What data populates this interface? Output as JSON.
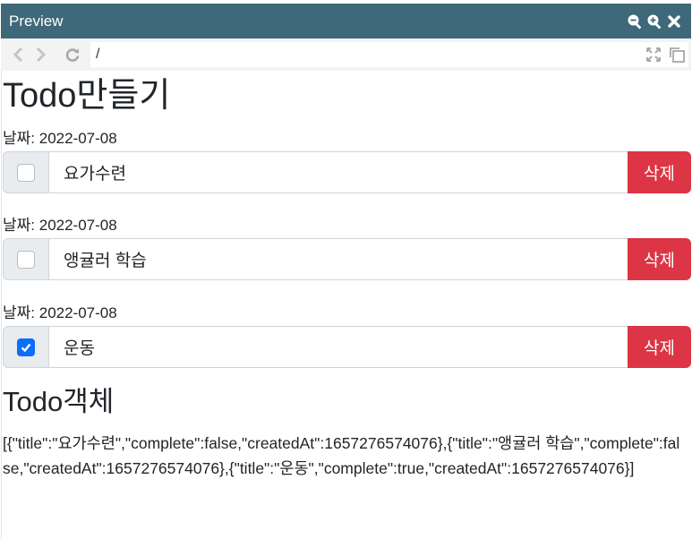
{
  "window": {
    "title": "Preview",
    "buttons": [
      "zoom-out-icon",
      "zoom-in-icon",
      "close-icon"
    ]
  },
  "toolbar": {
    "address_path": "/"
  },
  "colors": {
    "titlebar": "#3f6878",
    "danger": "#dc3545",
    "primary": "#0d6efd"
  },
  "app": {
    "heading": "Todo만들기",
    "date_label": "날짜: ",
    "delete_label": "삭제",
    "todos": [
      {
        "date": "2022-07-08",
        "title": "요가수련",
        "complete": false
      },
      {
        "date": "2022-07-08",
        "title": "앵귤러 학습",
        "complete": false
      },
      {
        "date": "2022-07-08",
        "title": "운동",
        "complete": true
      }
    ],
    "object_heading": "Todo객체",
    "object_json": "[{\"title\":\"요가수련\",\"complete\":false,\"createdAt\":1657276574076},{\"title\":\"앵귤러 학습\",\"complete\":false,\"createdAt\":1657276574076},{\"title\":\"운동\",\"complete\":true,\"createdAt\":1657276574076}]"
  }
}
